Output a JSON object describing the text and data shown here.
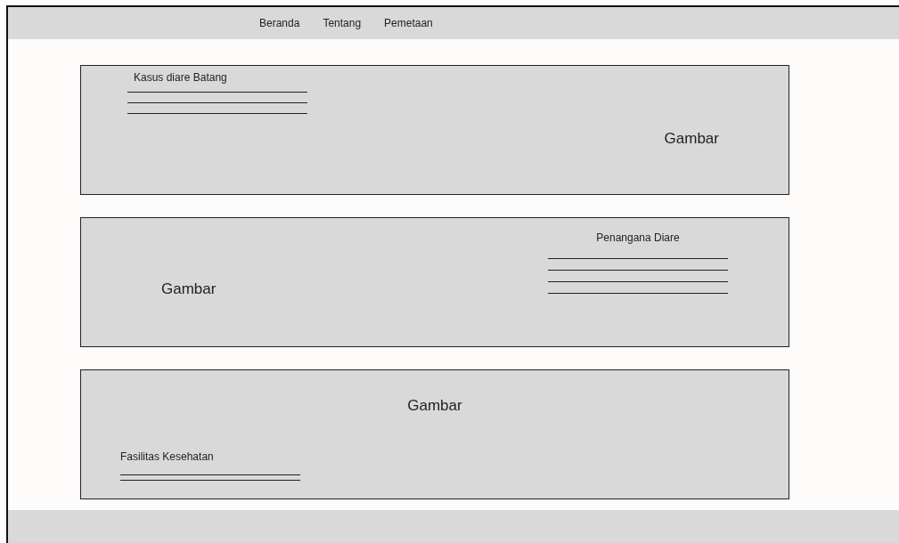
{
  "nav": [
    {
      "label": "Beranda"
    },
    {
      "label": "Tentang"
    },
    {
      "label": "Pemetaan"
    }
  ],
  "sections": [
    {
      "kind": "text-left",
      "title": "Kasus diare  Batang",
      "image_label": "Gambar"
    },
    {
      "kind": "text-right",
      "title": "Penangana Diare",
      "image_label": "Gambar"
    },
    {
      "kind": "text-bottom",
      "title": "Fasilitas Kesehatan",
      "image_label": "Gambar"
    }
  ]
}
